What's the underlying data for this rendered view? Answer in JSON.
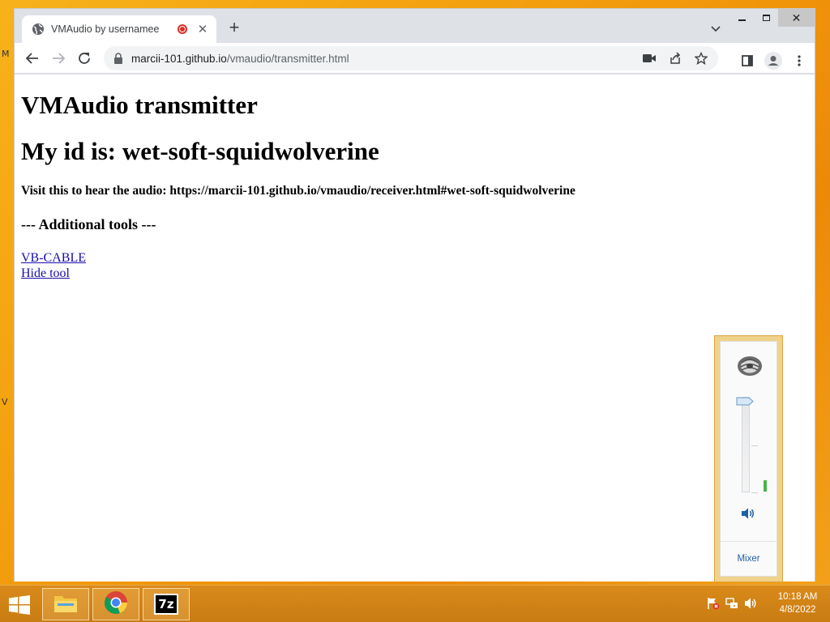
{
  "desktop": {
    "edge_glyph_1": "M",
    "edge_glyph_2": "V"
  },
  "browser": {
    "tab": {
      "title": "VMAudio by usernamee",
      "close_glyph": "✕",
      "recording": true
    },
    "new_tab_glyph": "+",
    "window_close_glyph": "✕",
    "address": {
      "host": "marcii-101.github.io",
      "path": "/vmaudio/transmitter.html"
    },
    "icons": [
      "back-arrow-icon",
      "forward-arrow-icon",
      "reload-icon",
      "lock-icon",
      "camera-icon",
      "share-icon",
      "star-icon",
      "side-panel-icon",
      "profile-icon",
      "menu-icon"
    ]
  },
  "page": {
    "title": "VMAudio transmitter",
    "id_heading": "My id is: wet-soft-squidwolverine",
    "visit_text": "Visit this to hear the audio: https://marcii-101.github.io/vmaudio/receiver.html#wet-soft-squidwolverine",
    "tools_heading": "--- Additional tools ---",
    "links": [
      {
        "label": "VB-CABLE"
      },
      {
        "label": "Hide tool"
      }
    ]
  },
  "volume_flyout": {
    "volume_level_percent": 100,
    "signal_level_percent": 12,
    "mixer_label": "Mixer"
  },
  "taskbar": {
    "apps": [
      "file-explorer",
      "chrome",
      "7-zip"
    ],
    "app_7zip_label": "7z",
    "clock_time": "10:18 AM",
    "clock_date": "4/8/2022"
  },
  "colors": {
    "desktop": "#f29a0c",
    "link": "#1a0dab",
    "recording": "#d93025",
    "meter_green": "#45b648"
  }
}
